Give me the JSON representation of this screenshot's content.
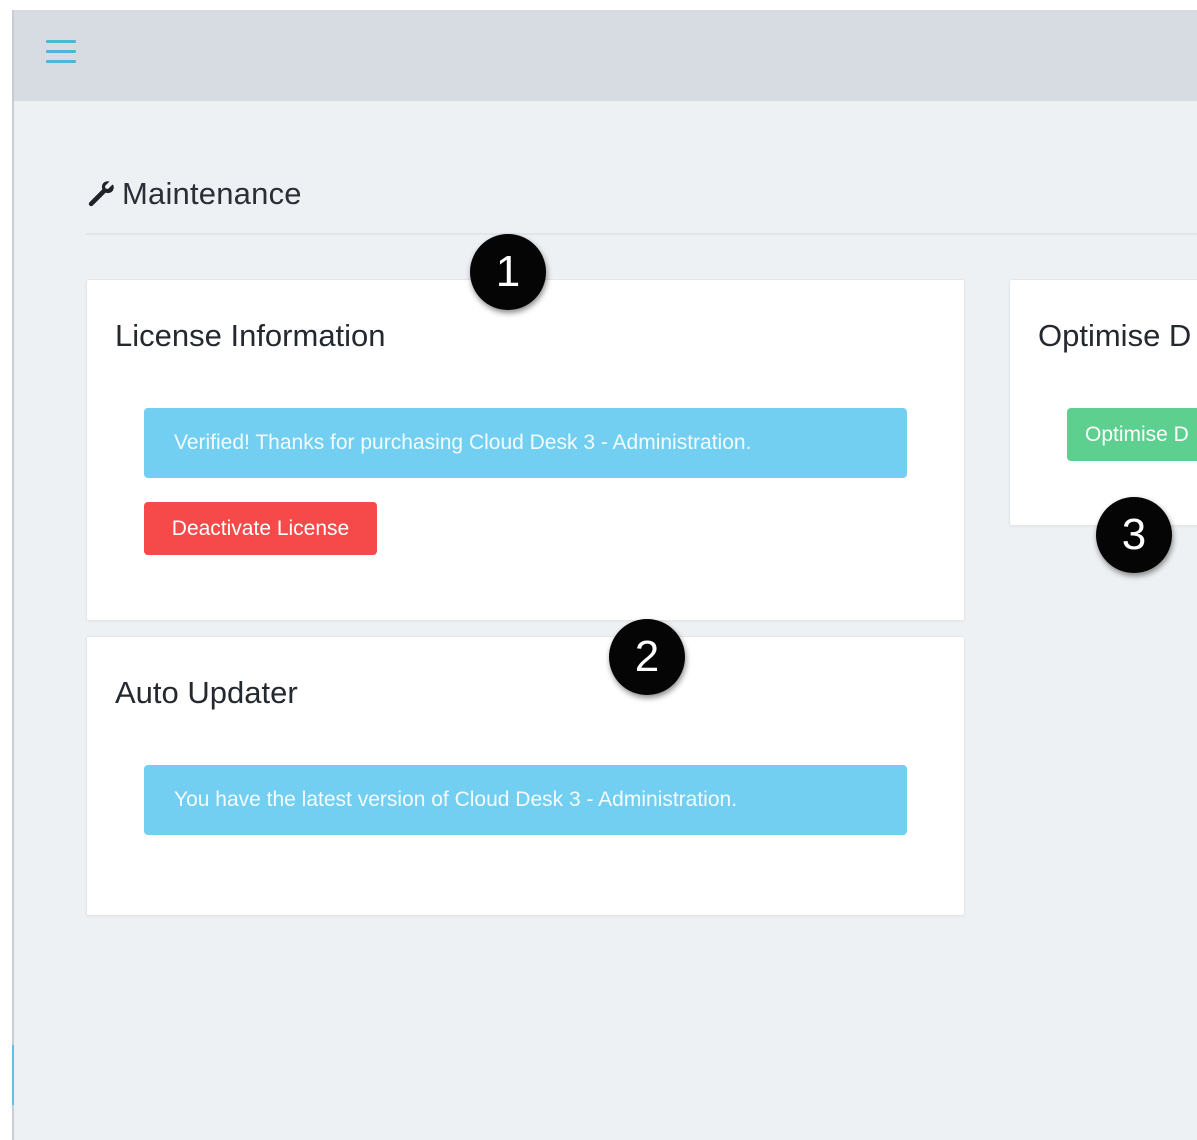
{
  "header": {
    "menu_icon": "hamburger-menu-icon"
  },
  "page": {
    "title": "Maintenance",
    "title_icon": "wrench-icon"
  },
  "license_card": {
    "title": "License Information",
    "alert_text": "Verified! Thanks for purchasing Cloud Desk 3 - Administration.",
    "deactivate_label": "Deactivate License"
  },
  "updater_card": {
    "title": "Auto Updater",
    "alert_text": "You have the latest version of Cloud Desk 3 - Administration."
  },
  "optimise_card": {
    "title": "Optimise D",
    "button_label": "Optimise D"
  },
  "markers": [
    "1",
    "2",
    "3"
  ],
  "colors": {
    "topbar": "#d7dbe2",
    "content_bg": "#eef1f4",
    "info_alert": "#72cff2",
    "danger_button": "#f64a4a",
    "success_button": "#5dcf8f",
    "menu_icon": "#4fb6d6"
  }
}
